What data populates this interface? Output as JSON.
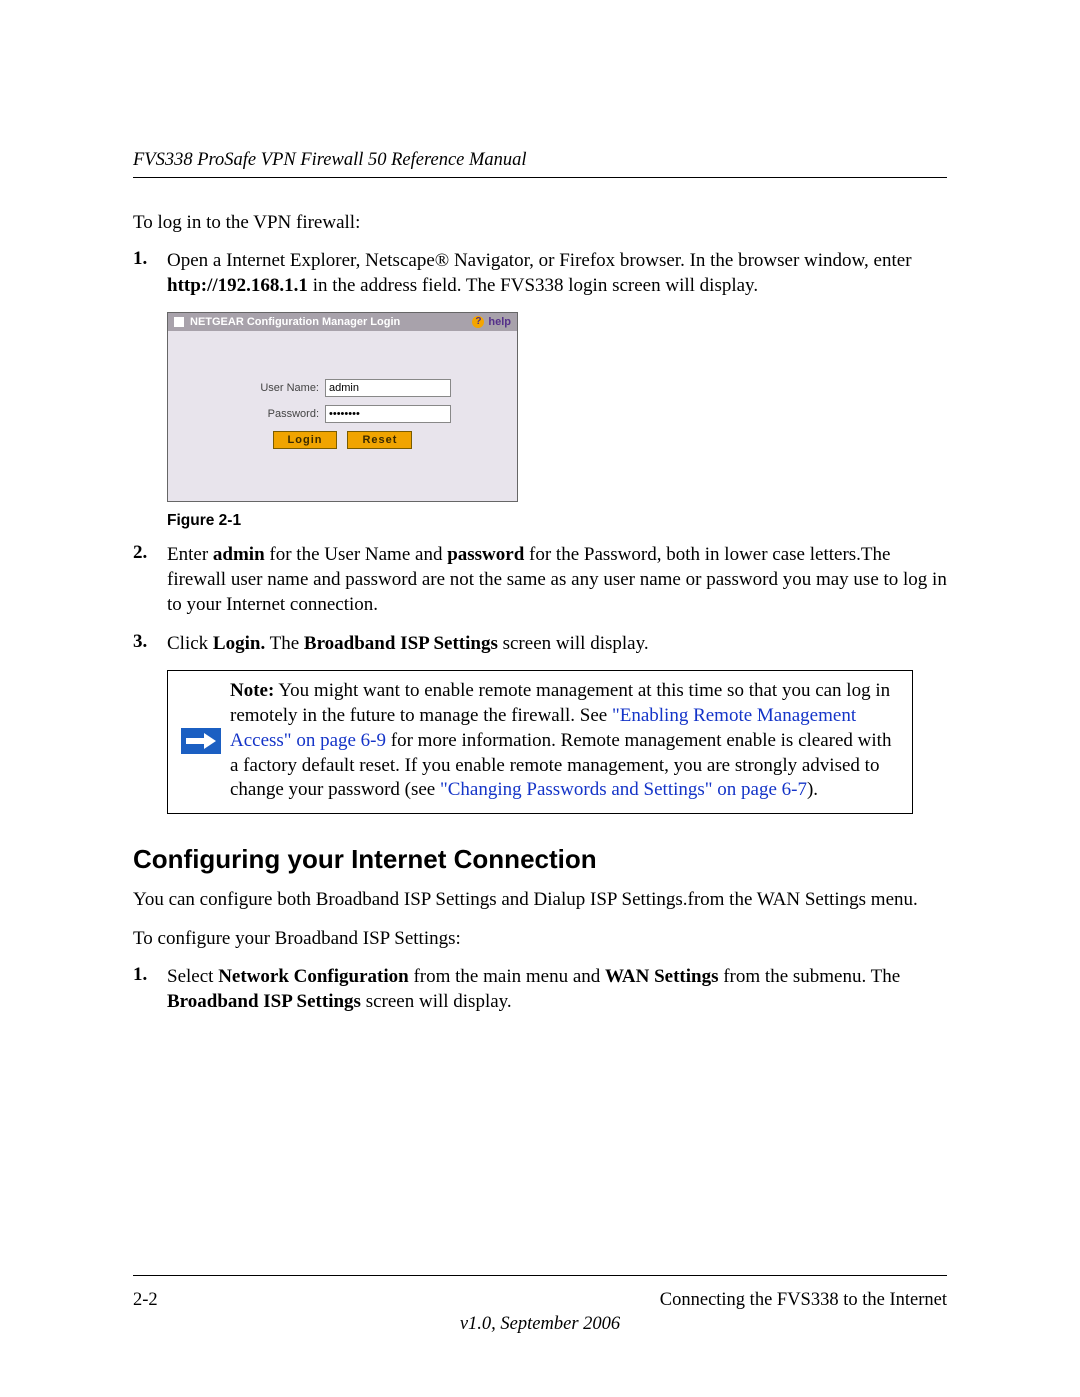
{
  "header": {
    "title": "FVS338 ProSafe VPN Firewall 50 Reference Manual"
  },
  "body": {
    "intro": "To log in to the VPN firewall:",
    "step1": {
      "num": "1.",
      "p1a": "Open a Internet Explorer, Netscape® Navigator, or Firefox browser. In the browser window, enter ",
      "url": "http://192.168.1.1",
      "p1b": " in the address field. The FVS338 login screen will display."
    },
    "figure": {
      "header": "NETGEAR Configuration Manager Login",
      "help": "help",
      "userLabel": "User Name:",
      "userValue": "admin",
      "passLabel": "Password:",
      "passValue": "••••••••",
      "loginBtn": "Login",
      "resetBtn": "Reset",
      "caption": "Figure 2-1"
    },
    "step2": {
      "num": "2.",
      "a": "Enter ",
      "b": "admin",
      "c": " for the User Name and ",
      "d": "password",
      "e": " for the Password, both in lower case letters.The firewall user name and password are not the same as any user name or password you may use to log in to your Internet connection."
    },
    "step3": {
      "num": "3.",
      "a": "Click ",
      "b": "Login.",
      "c": " The ",
      "d": "Broadband ISP Settings",
      "e": " screen will display."
    },
    "note": {
      "lead": "Note:",
      "t1": " You might want to enable remote management at this time so that you can log in remotely in the future to manage the firewall. See ",
      "link1": "\"Enabling Remote Management Access\" on page 6-9",
      "t2": " for more information. Remote management enable is cleared with a factory default reset. If you enable remote management, you are strongly advised to change your password (see ",
      "link2": "\"Changing Passwords and Settings\" on page 6-7",
      "t3": ")."
    },
    "section": "Configuring your Internet Connection",
    "sectText1": "You can configure both Broadband ISP Settings and Dialup ISP Settings.from the WAN Settings menu.",
    "sectText2": "To configure your Broadband ISP Settings:",
    "stepA": {
      "num": "1.",
      "a": "Select ",
      "b": "Network Configuration",
      "c": " from the main menu and ",
      "d": "WAN Settings",
      "e": " from the submenu. The ",
      "f": "Broadband ISP Settings",
      "g": " screen will display."
    }
  },
  "footer": {
    "pageNum": "2-2",
    "chapter": "Connecting the FVS338 to the Internet",
    "version": "v1.0, September 2006"
  }
}
